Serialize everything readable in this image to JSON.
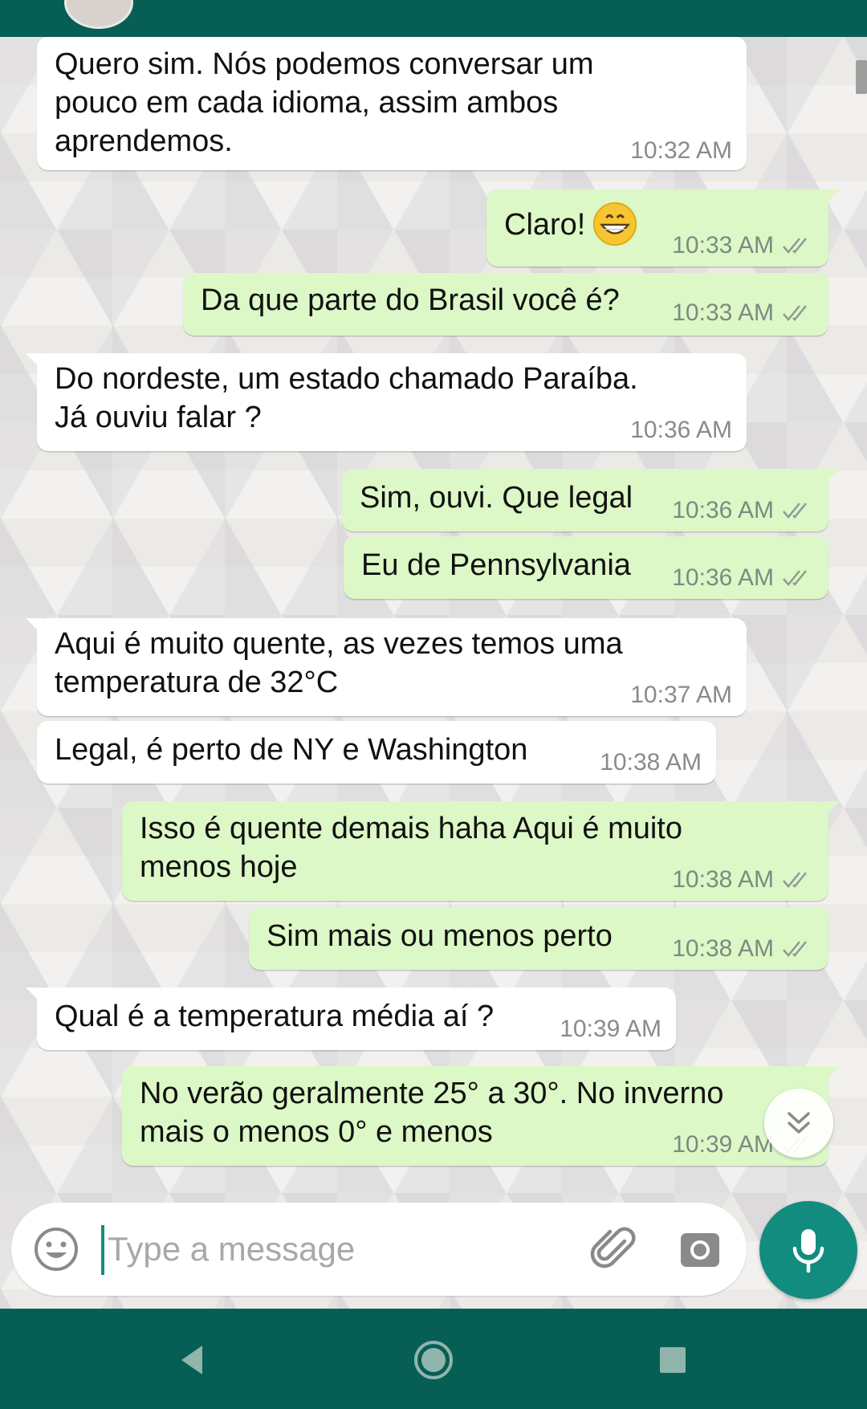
{
  "messages": [
    {
      "dir": "in",
      "lines": [
        "Quero sim. Nós podemos conversar um",
        "pouco em cada idioma, assim ambos",
        "aprendemos."
      ],
      "time": "10:32 AM"
    },
    {
      "dir": "out",
      "lines": [
        "Claro!"
      ],
      "emoji": "grinning-face-emoji",
      "time": "10:33 AM",
      "status": "read"
    },
    {
      "dir": "out",
      "lines": [
        "Da que parte do Brasil você é?"
      ],
      "time": "10:33 AM",
      "status": "read"
    },
    {
      "dir": "in",
      "lines": [
        "Do nordeste, um estado chamado Paraíba.",
        "Já ouviu falar ?"
      ],
      "time": "10:36 AM"
    },
    {
      "dir": "out",
      "lines": [
        "Sim, ouvi. Que legal"
      ],
      "time": "10:36 AM",
      "status": "read"
    },
    {
      "dir": "out",
      "lines": [
        "Eu de Pennsylvania"
      ],
      "time": "10:36 AM",
      "status": "read"
    },
    {
      "dir": "in",
      "lines": [
        "Aqui é muito quente, as vezes temos uma",
        "temperatura de 32°C"
      ],
      "time": "10:37 AM"
    },
    {
      "dir": "in",
      "lines": [
        "Legal, é perto de NY e Washington"
      ],
      "time": "10:38 AM"
    },
    {
      "dir": "out",
      "lines": [
        "Isso é quente demais haha Aqui  é muito",
        "menos hoje"
      ],
      "time": "10:38 AM",
      "status": "read"
    },
    {
      "dir": "out",
      "lines": [
        "Sim mais ou menos perto"
      ],
      "time": "10:38 AM",
      "status": "read"
    },
    {
      "dir": "in",
      "lines": [
        "Qual é a temperatura média aí ?"
      ],
      "time": "10:39 AM"
    },
    {
      "dir": "out",
      "lines": [
        "No verão geralmente 25° a 30°. No inverno",
        "mais o menos 0° e menos"
      ],
      "time": "10:39 AM",
      "status": "read"
    }
  ],
  "composer": {
    "placeholder": "Type a message",
    "icons": [
      "emoji-icon",
      "attach-icon",
      "camera-icon",
      "mic-icon"
    ]
  },
  "colors": {
    "header": "#075e54",
    "accent": "#128c7e",
    "outgoing_bubble": "#dcf8c6",
    "incoming_bubble": "#ffffff",
    "read_ticks": "#8f9a93"
  }
}
